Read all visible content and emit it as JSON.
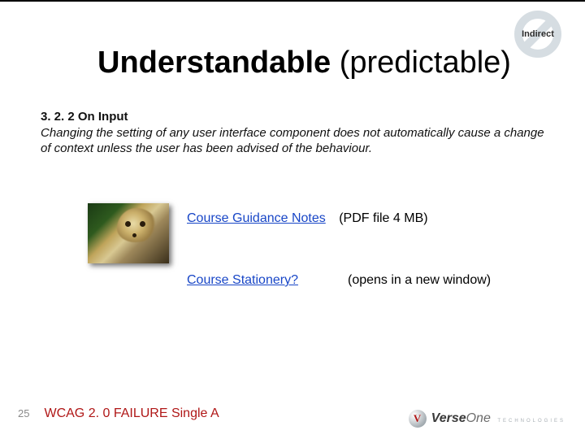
{
  "badge": {
    "label": "Indirect"
  },
  "title": {
    "strong": "Understandable",
    "sub": "(predictable)"
  },
  "section": {
    "heading": "3. 2. 2 On Input",
    "body": "Changing the setting of any user interface component does not automatically cause a change of context unless the user has been advised of the behaviour."
  },
  "links": {
    "guidance": {
      "text": "Course Guidance Notes",
      "note": "(PDF file 4 MB)"
    },
    "stationery": {
      "text": "Course Stationery?",
      "note": "(opens in a new window)"
    }
  },
  "footer": {
    "page": "25",
    "failure": "WCAG 2. 0 FAILURE Single A",
    "logo": {
      "lead": "Verse",
      "rest": "One",
      "tech": "TECHNOLOGIES"
    }
  }
}
